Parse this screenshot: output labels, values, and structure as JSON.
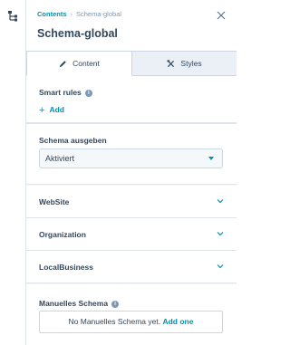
{
  "breadcrumb": {
    "parent": "Contents",
    "separator": "›",
    "current": "Schema-global"
  },
  "title": "Schema-global",
  "tabs": [
    {
      "label": "Content",
      "icon": "pencil-icon",
      "active": true
    },
    {
      "label": "Styles",
      "icon": "brush-icon",
      "active": false
    }
  ],
  "smart_rules": {
    "label": "Smart rules",
    "add_label": "Add"
  },
  "schema_output": {
    "label": "Schema ausgeben",
    "selected": "Aktiviert"
  },
  "accordions": [
    {
      "label": "WebSite"
    },
    {
      "label": "Organization"
    },
    {
      "label": "LocalBusiness"
    }
  ],
  "manual_schema": {
    "label": "Manuelles Schema",
    "empty_text": "No Manuelles Schema yet.",
    "add_one_label": "Add one"
  },
  "colors": {
    "accent": "#0091ae",
    "text": "#33475b",
    "border": "#cbd6e2"
  }
}
